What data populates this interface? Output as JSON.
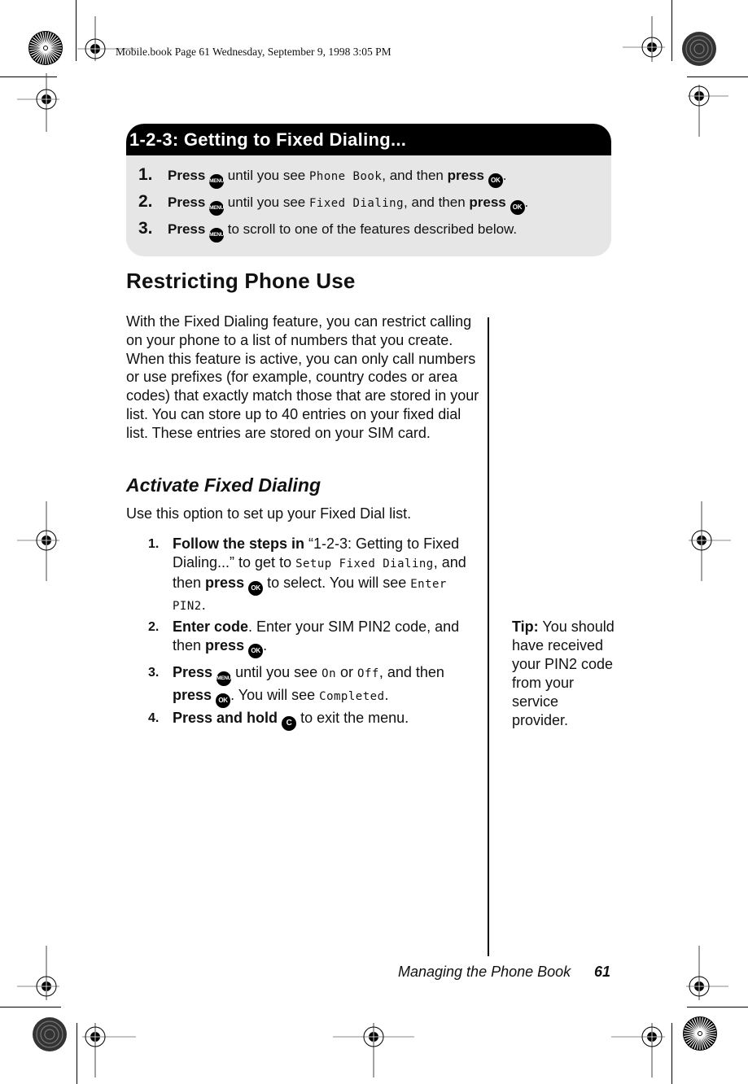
{
  "slug": "Mobile.book  Page 61  Wednesday, September 9, 1998  3:05 PM",
  "quick_box": {
    "title": "1-2-3: Getting to Fixed Dialing...",
    "steps": [
      {
        "num": "1.",
        "press": "Press",
        "key1": "MENU",
        "mid": " until you see ",
        "lcd": "Phone Book",
        "after": ", and then ",
        "press2": "press",
        "key2": "OK",
        "end": "."
      },
      {
        "num": "2.",
        "press": "Press",
        "key1": "MENU",
        "mid": " until you see ",
        "lcd": "Fixed Dialing",
        "after": ", and then ",
        "press2": "press",
        "key2": "OK",
        "end": "."
      },
      {
        "num": "3.",
        "press": "Press",
        "key1": "MENU",
        "mid": " to scroll to one of the features described below."
      }
    ]
  },
  "section_title": "Restricting Phone Use",
  "intro_paragraph": "With the Fixed Dialing feature, you can restrict calling on your phone to a list of numbers that you create. When this feature is active, you can only call numbers or use prefixes (for example, country codes or area codes) that exactly match those that are stored in your list. You can store up to 40 entries on your fixed dial list. These entries are stored on your SIM card.",
  "subsection": {
    "title": "Activate Fixed Dialing",
    "intro": "Use this option to set up your Fixed Dial list.",
    "steps": [
      {
        "num": "1.",
        "b1": "Follow the steps in",
        "t1": " “1-2-3: Getting to Fixed Dialing...” to get to ",
        "lcd1": "Setup Fixed Dialing",
        "t2": ", and then ",
        "b2": "press",
        "key": "OK",
        "t3": " to select. You will see ",
        "lcd2": "Enter PIN2",
        "t4": "."
      },
      {
        "num": "2.",
        "b1": "Enter code",
        "t1": ". Enter your SIM PIN2 code, and then ",
        "b2": "press",
        "key": "OK",
        "t2": "."
      },
      {
        "num": "3.",
        "b1": "Press",
        "key1": "MENU",
        "t1": " until you see ",
        "lcd1": "On",
        "t2": " or ",
        "lcd2": "Off",
        "t3": ", and then ",
        "b2": "press",
        "key2": "OK",
        "t4": ". You will see ",
        "lcd3": "Completed",
        "t5": "."
      },
      {
        "num": "4.",
        "b1": "Press and hold",
        "key": "C",
        "t1": " to exit the menu."
      }
    ]
  },
  "tip": {
    "label": "Tip:",
    "text": " You should have received your PIN2 code from your service provider."
  },
  "footer": {
    "section": "Managing the Phone Book",
    "page": "61"
  },
  "icons": {
    "menu_key": "menu-key-icon",
    "ok_key": "ok-key-icon",
    "clear_key": "c-key-icon",
    "registration_mark": "registration-mark-icon",
    "starburst": "starburst-target-icon"
  }
}
